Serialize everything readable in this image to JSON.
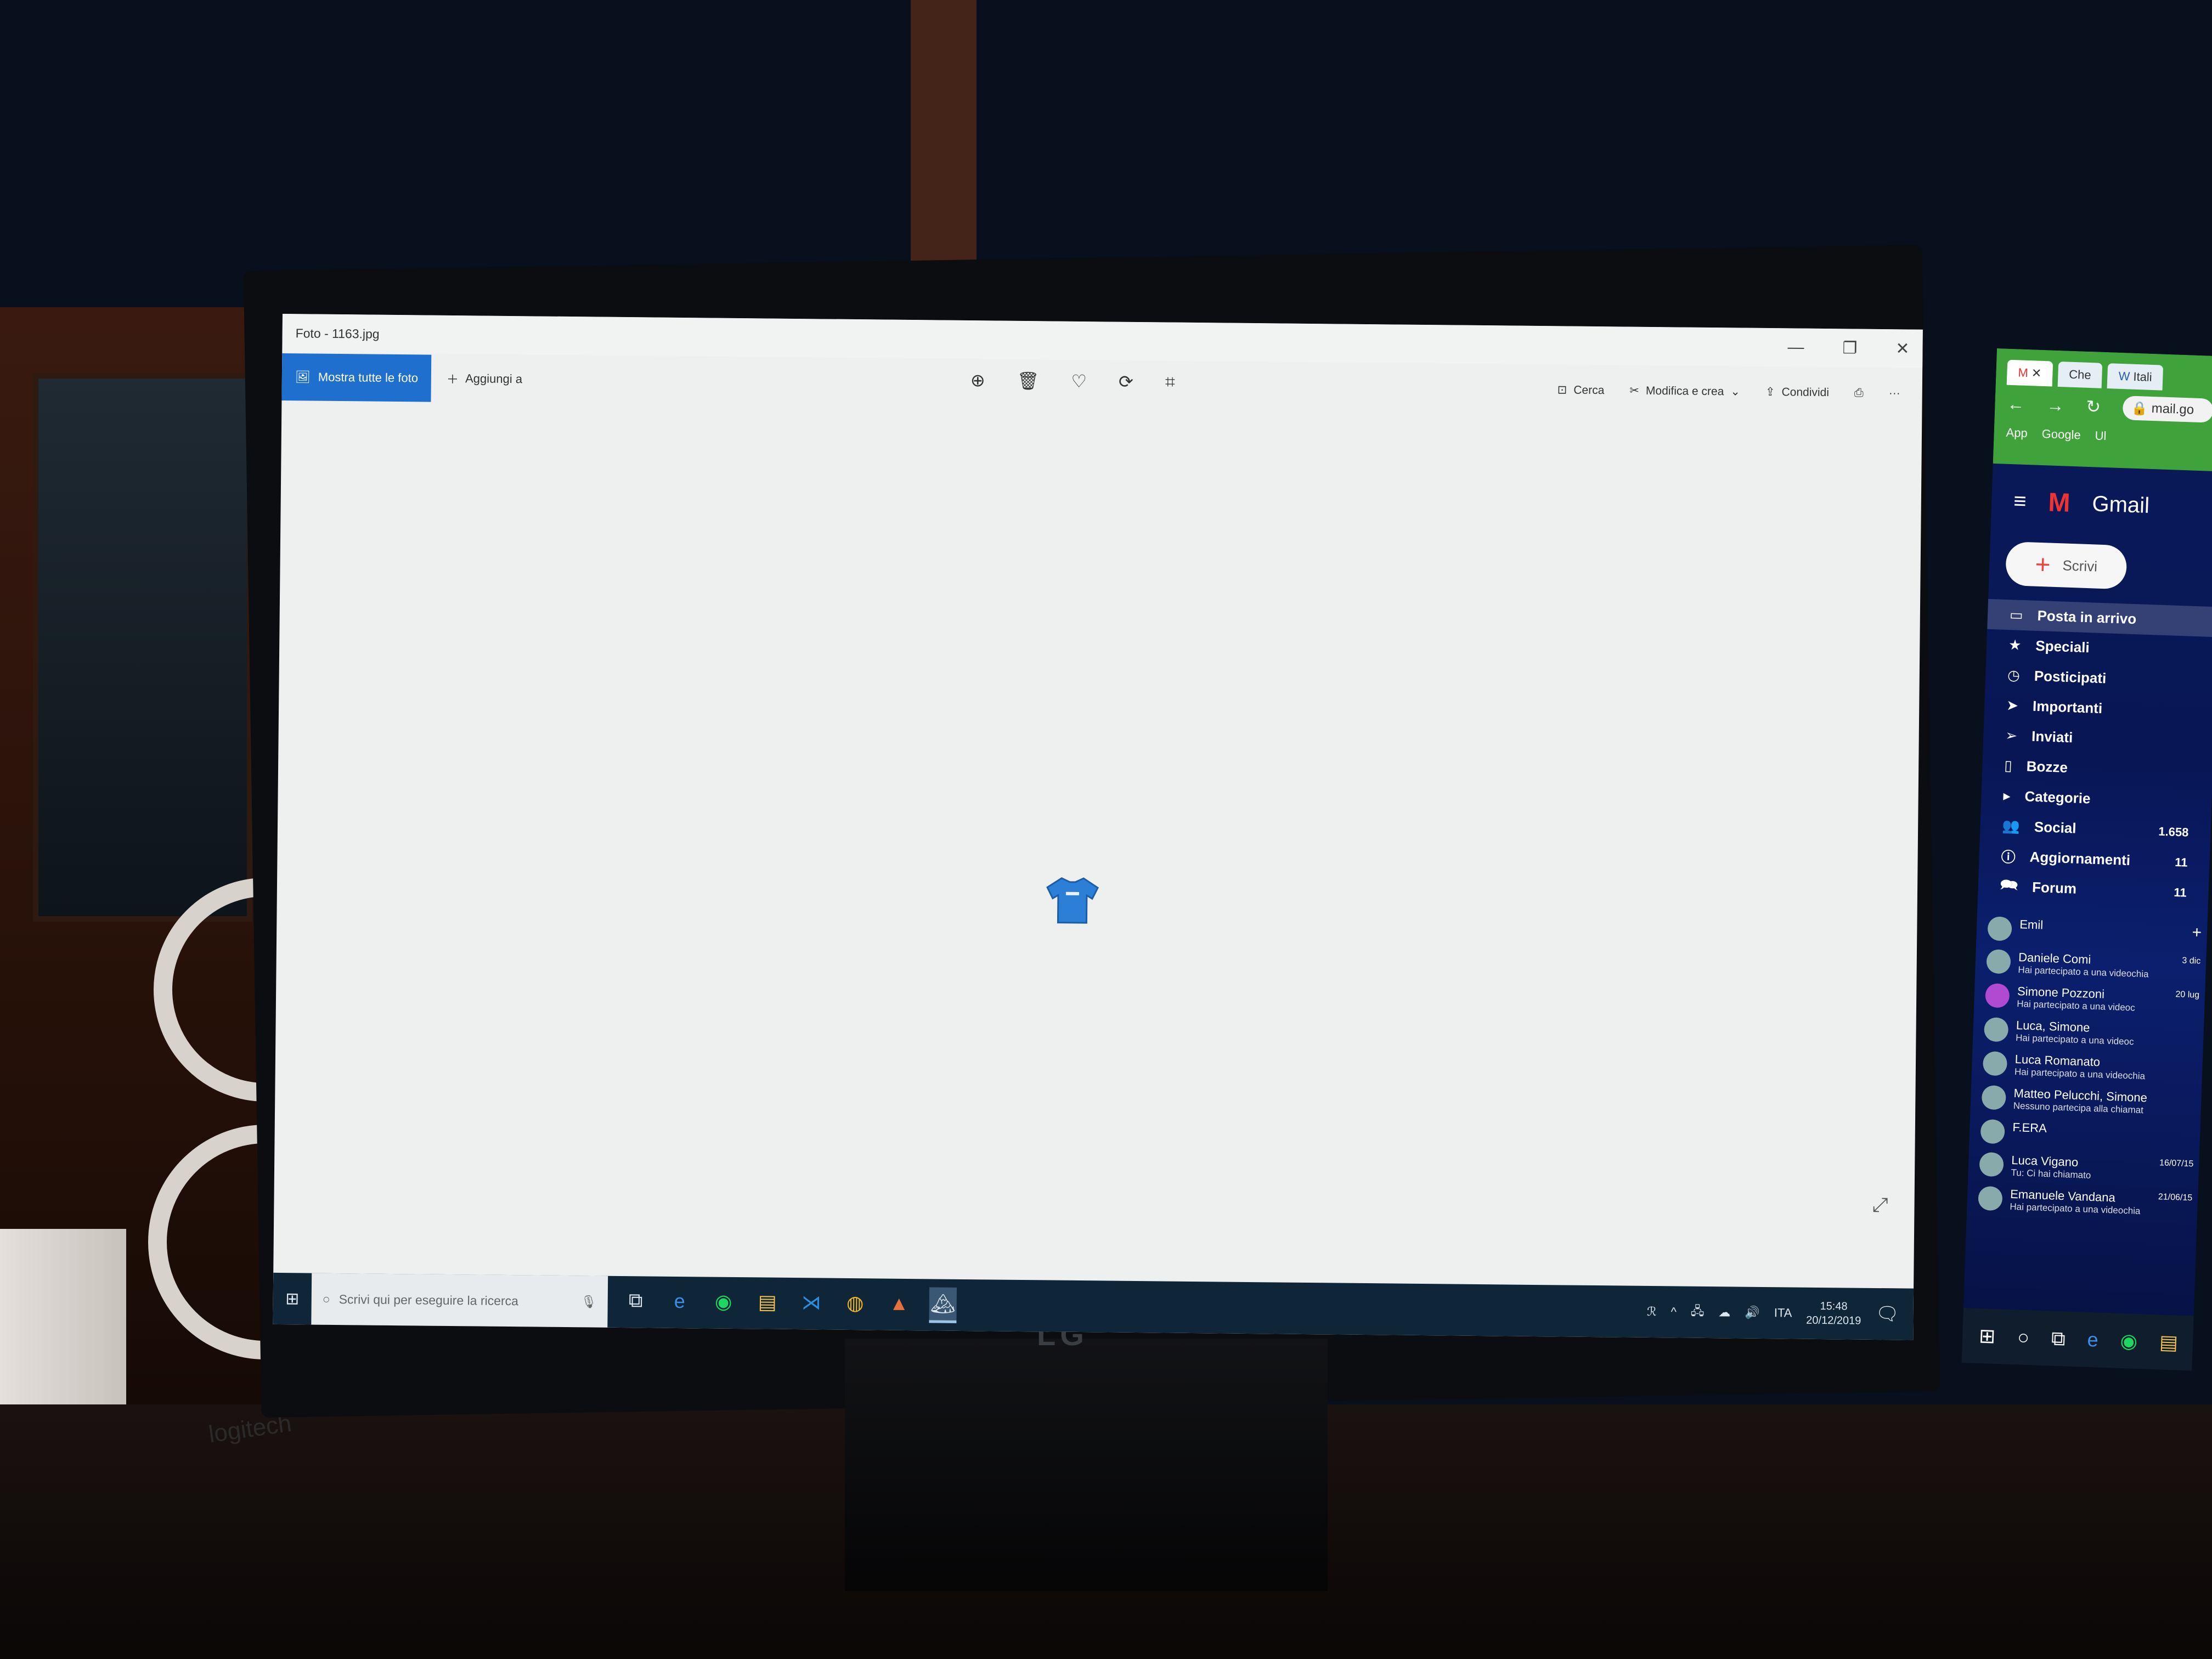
{
  "photos_app": {
    "title": "Foto - 1163.jpg",
    "window_controls": [
      "—",
      "❐",
      "✕"
    ],
    "show_all_label": "Mostra tutte le foto",
    "add_to_label": "Aggiungi a",
    "search_label": "Cerca",
    "edit_label": "Modifica e crea",
    "share_label": "Condividi",
    "more_label": "···"
  },
  "taskbar": {
    "search_placeholder": "Scrivi qui per eseguire la ricerca",
    "language": "ITA",
    "time": "15:48",
    "date": "20/12/2019"
  },
  "monitor_brand": "LG",
  "logitech_text": "logitech",
  "gmail": {
    "tabs": [
      "Che",
      "Itali"
    ],
    "url": "mail.go",
    "bookmarks": [
      "App",
      "Google",
      "Ul"
    ],
    "logo_text": "Gmail",
    "compose_label": "Scrivi",
    "nav": [
      {
        "label": "Posta in arrivo",
        "count": ""
      },
      {
        "label": "Speciali",
        "count": ""
      },
      {
        "label": "Posticipati",
        "count": ""
      },
      {
        "label": "Importanti",
        "count": ""
      },
      {
        "label": "Inviati",
        "count": ""
      },
      {
        "label": "Bozze",
        "count": ""
      },
      {
        "label": "Categorie",
        "count": ""
      },
      {
        "label": "Social",
        "count": "1.658"
      },
      {
        "label": "Aggiornamenti",
        "count": "11"
      },
      {
        "label": "Forum",
        "count": "11"
      }
    ],
    "chat_user": "Emil",
    "chats": [
      {
        "name": "Daniele Comi",
        "sub": "Hai partecipato a una videochia",
        "date": "3 dic"
      },
      {
        "name": "Simone Pozzoni",
        "sub": "Hai partecipato a una videoc",
        "date": "20 lug"
      },
      {
        "name": "Luca, Simone",
        "sub": "Hai partecipato a una videoc",
        "date": ""
      },
      {
        "name": "Luca Romanato",
        "sub": "Hai partecipato a una videochia",
        "date": ""
      },
      {
        "name": "Matteo Pelucchi, Simone",
        "sub": "Nessuno partecipa alla chiamat",
        "date": ""
      },
      {
        "name": "F.ERA",
        "sub": "",
        "date": ""
      },
      {
        "name": "Luca Vigano",
        "sub": "Tu: Ci hai chiamato",
        "date": "16/07/15"
      },
      {
        "name": "Emanuele Vandana",
        "sub": "Hai partecipato a una videochia",
        "date": "21/06/15"
      }
    ]
  }
}
